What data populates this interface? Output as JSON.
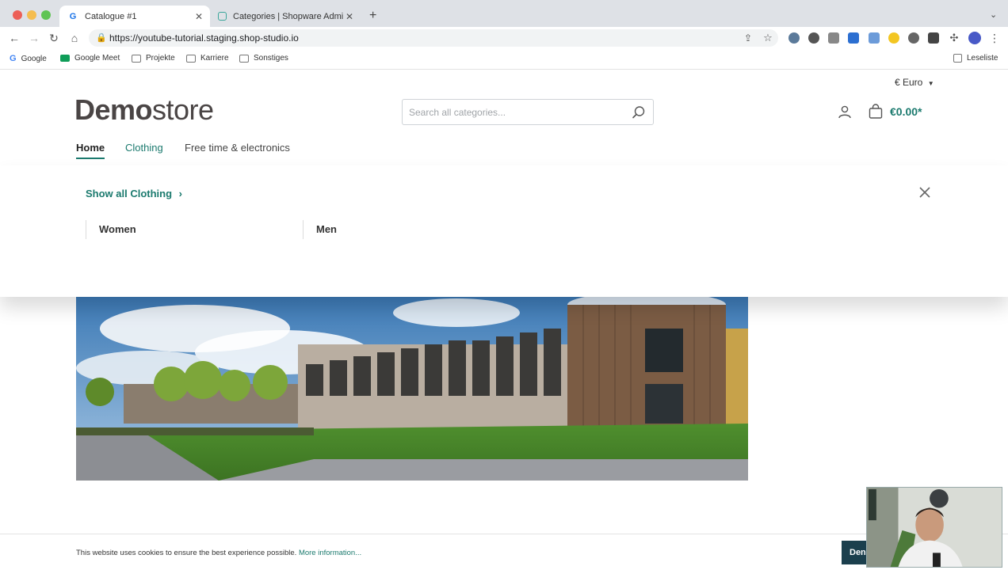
{
  "browser": {
    "tabs": [
      {
        "title": "Catalogue #1",
        "active": true
      },
      {
        "title": "Categories | Shopware Admini",
        "active": false
      }
    ],
    "url": "https://youtube-tutorial.staging.shop-studio.io",
    "bookmarks": [
      "Google",
      "Google Meet",
      "Projekte",
      "Karriere",
      "Sonstiges"
    ],
    "reading_list": "Leseliste"
  },
  "store": {
    "currency": "€ Euro",
    "logo": {
      "bold": "Demo",
      "regular": "store"
    },
    "search": {
      "placeholder": "Search all categories..."
    },
    "cart_total": "€0.00*",
    "nav": [
      {
        "label": "Home",
        "state": "active"
      },
      {
        "label": "Clothing",
        "state": "hover"
      },
      {
        "label": "Free time & electronics",
        "state": "default"
      }
    ],
    "flyout": {
      "show_all": "Show all Clothing",
      "columns": [
        "Women",
        "Men"
      ]
    },
    "cookie": {
      "text": "This website uses cookies to ensure the best experience possible.",
      "link": "More information...",
      "button": "Deny"
    }
  },
  "colors": {
    "accent": "#1b7a6e",
    "dark": "#1b3f4d"
  }
}
